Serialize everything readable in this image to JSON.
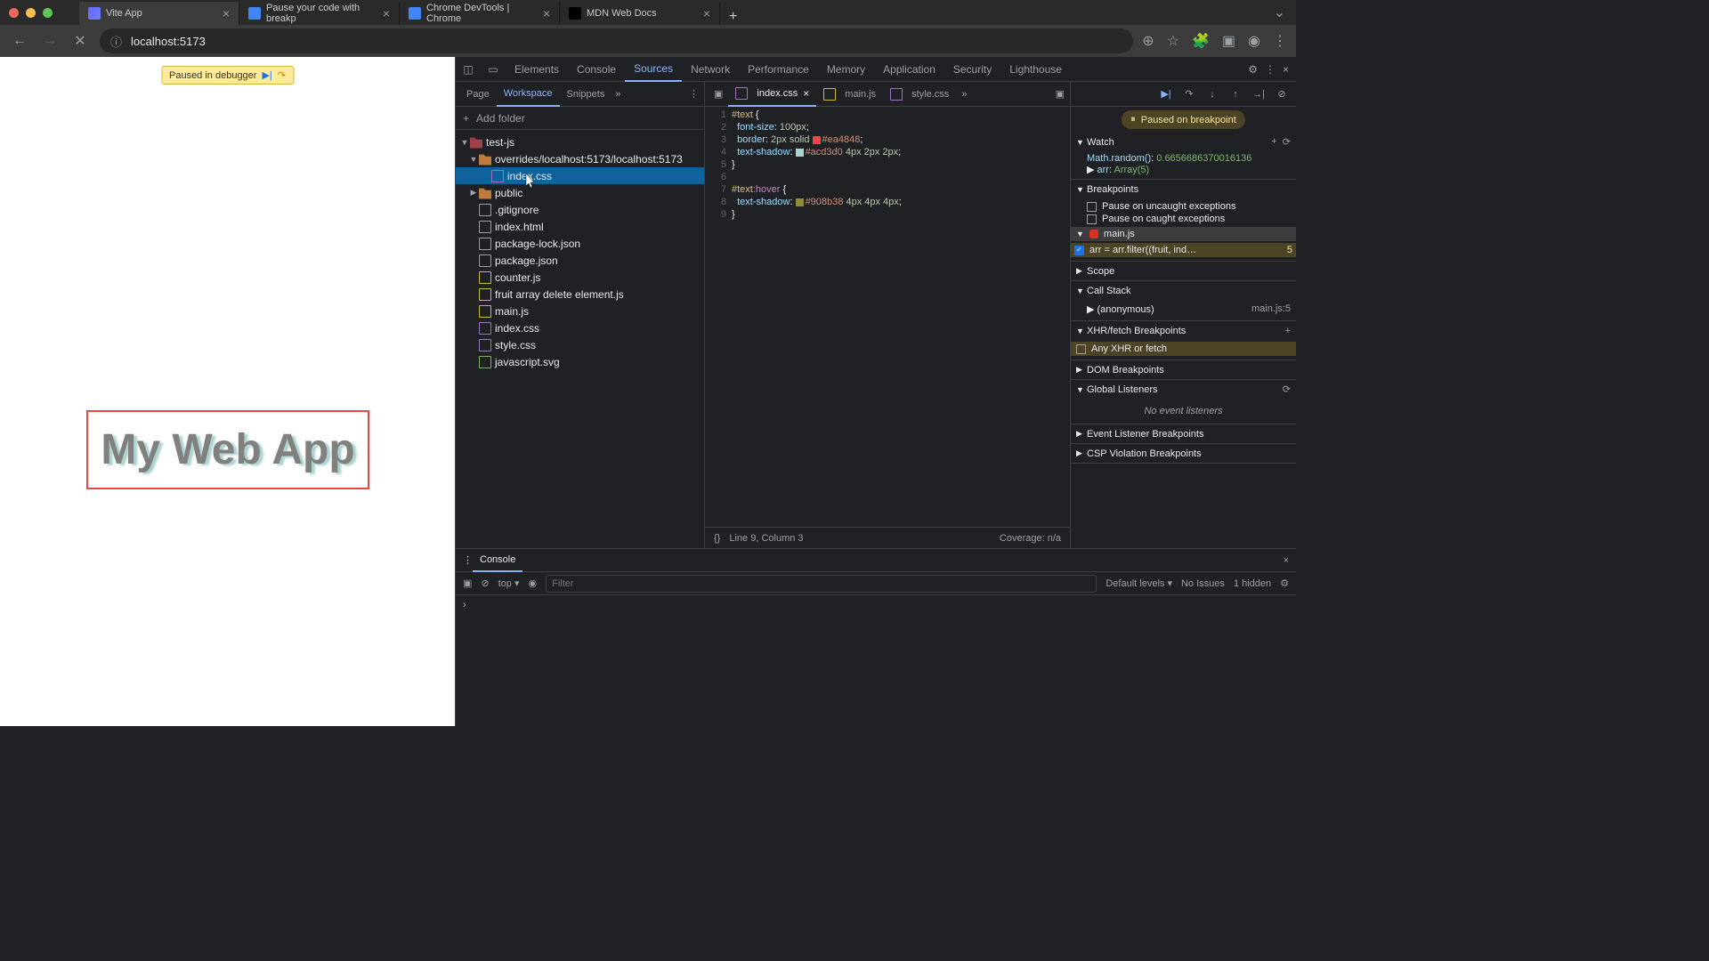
{
  "browser": {
    "tabs": [
      {
        "title": "Vite App",
        "active": true
      },
      {
        "title": "Pause your code with breakp",
        "active": false
      },
      {
        "title": "Chrome DevTools | Chrome",
        "active": false
      },
      {
        "title": "MDN Web Docs",
        "active": false
      }
    ],
    "url": "localhost:5173"
  },
  "viewport": {
    "debugger_toast": "Paused in debugger",
    "app_text": "My Web App"
  },
  "devtools": {
    "tabs": [
      "Elements",
      "Console",
      "Sources",
      "Network",
      "Performance",
      "Memory",
      "Application",
      "Security",
      "Lighthouse"
    ],
    "active_tab": "Sources",
    "sources": {
      "subtabs": [
        "Page",
        "Workspace",
        "Snippets"
      ],
      "active_subtab": "Workspace",
      "add_folder": "Add folder",
      "tree": {
        "root": "test-js",
        "overrides": "overrides/localhost:5173/localhost:5173",
        "selected_file": "index.css",
        "public": "public",
        "files": [
          ".gitignore",
          "index.html",
          "package-lock.json",
          "package.json",
          "counter.js",
          "fruit array delete element.js",
          "main.js",
          "index.css",
          "style.css",
          "javascript.svg"
        ]
      },
      "editor": {
        "tabs": [
          {
            "name": "index.css",
            "active": true
          },
          {
            "name": "main.js",
            "active": false
          },
          {
            "name": "style.css",
            "active": false
          }
        ],
        "code_lines": [
          "#text {",
          "  font-size: 100px;",
          "  border: 2px solid #ea4848;",
          "  text-shadow: #acd3d0 4px 2px 2px;",
          "}",
          "",
          "#text:hover {",
          "  text-shadow: #908b38 4px 4px 4px;",
          "}"
        ],
        "status_line": "Line 9, Column 3",
        "coverage": "Coverage: n/a"
      },
      "debugger": {
        "banner": "Paused on breakpoint",
        "watch": {
          "label": "Watch",
          "items": [
            {
              "expr": "Math.random()",
              "val": "0.6656686370016136"
            },
            {
              "expr": "arr",
              "val": "Array(5)"
            }
          ]
        },
        "breakpoints": {
          "label": "Breakpoints",
          "uncaught": "Pause on uncaught exceptions",
          "caught": "Pause on caught exceptions",
          "file": "main.js",
          "line_text": "arr = arr.filter((fruit, ind…",
          "line_num": "5"
        },
        "scope": "Scope",
        "callstack": {
          "label": "Call Stack",
          "anon": "(anonymous)",
          "loc": "main.js:5"
        },
        "xhr": {
          "label": "XHR/fetch Breakpoints",
          "any": "Any XHR or fetch"
        },
        "dom": "DOM Breakpoints",
        "listeners": {
          "label": "Global Listeners",
          "empty": "No event listeners"
        },
        "event": "Event Listener Breakpoints",
        "csp": "CSP Violation Breakpoints"
      }
    },
    "console": {
      "tab": "Console",
      "context": "top",
      "filter_placeholder": "Filter",
      "levels": "Default levels",
      "issues": "No Issues",
      "hidden": "1 hidden"
    }
  }
}
